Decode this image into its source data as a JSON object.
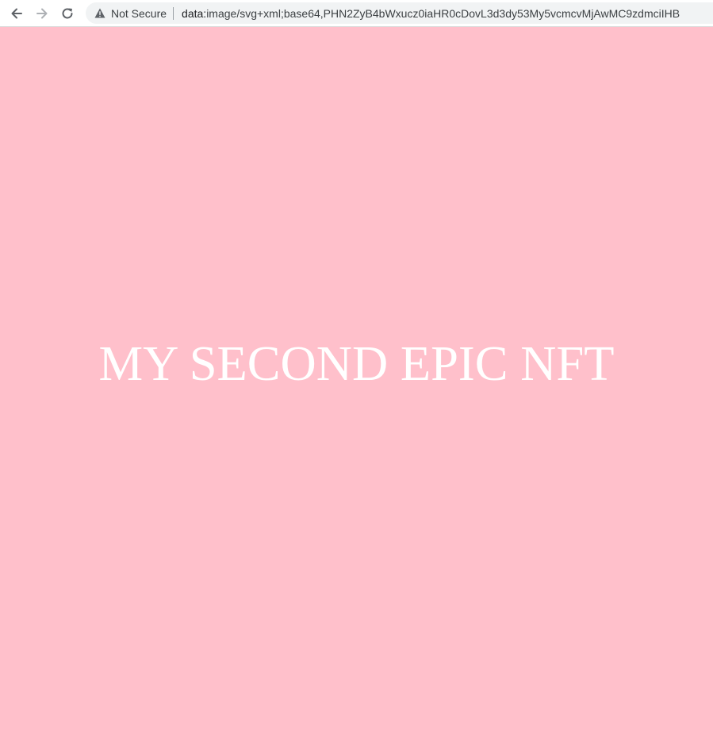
{
  "browser": {
    "security_label": "Not Secure",
    "url_scheme": "data:",
    "url_rest": "image/svg+xml;base64,PHN2ZyB4bWxucz0iaHR0cDovL3d3dy53My5vcmcvMjAwMC9zdmciIHB",
    "icons": {
      "back": "arrow-left-icon",
      "forward": "arrow-right-icon",
      "reload": "reload-icon",
      "warning": "warning-triangle-icon"
    }
  },
  "nft": {
    "text": "MY SECOND EPIC NFT",
    "background_color": "#ffc0cb",
    "text_color": "#ffffff"
  }
}
